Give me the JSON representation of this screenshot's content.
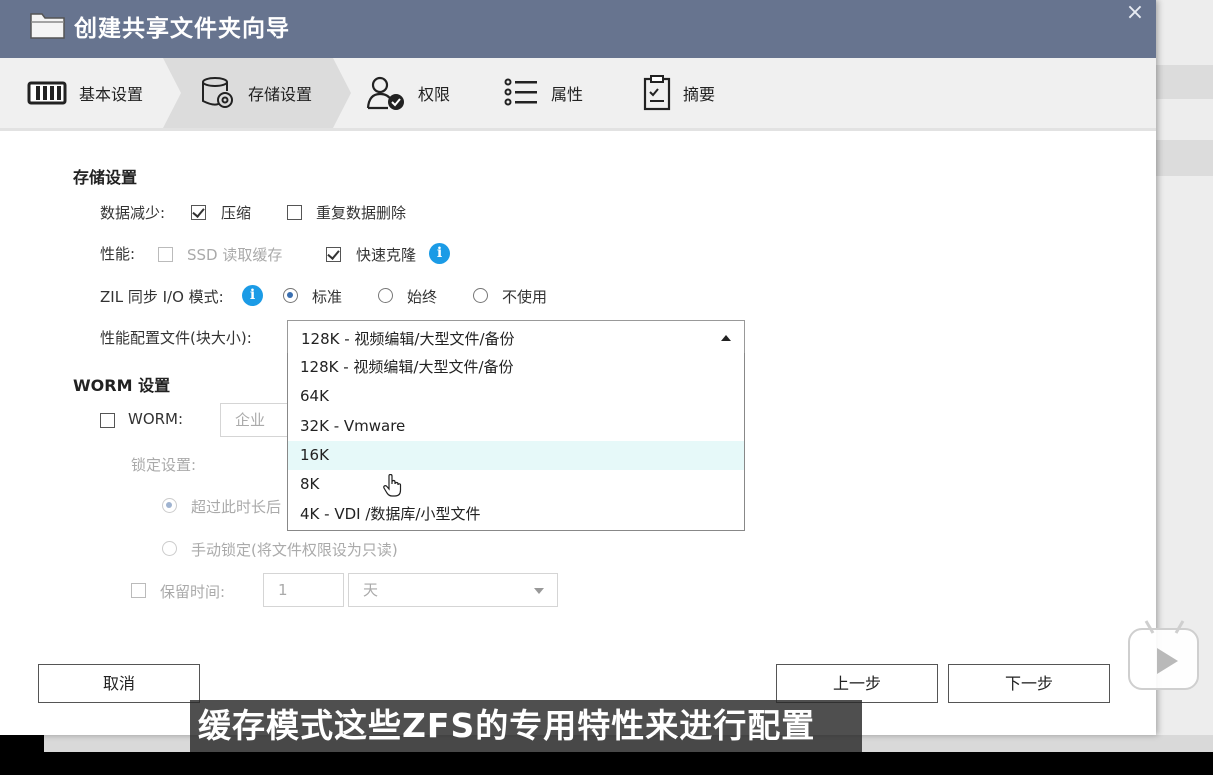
{
  "window": {
    "title": "创建共享文件夹向导",
    "close_glyph": "×"
  },
  "steps": [
    {
      "label": "基本设置",
      "icon": "hard-drive-icon"
    },
    {
      "label": "存储设置",
      "icon": "storage-gear-icon",
      "active": true
    },
    {
      "label": "权限",
      "icon": "user-check-icon"
    },
    {
      "label": "属性",
      "icon": "list-icon"
    },
    {
      "label": "摘要",
      "icon": "clipboard-icon"
    }
  ],
  "storage": {
    "section_title": "存储设置",
    "data_reduction_label": "数据减少:",
    "compression_label": "压缩",
    "compression_checked": true,
    "dedup_label": "重复数据删除",
    "dedup_checked": false,
    "performance_label": "性能:",
    "ssd_cache_label": "SSD 读取缓存",
    "ssd_cache_checked": false,
    "fast_clone_label": "快速克隆",
    "fast_clone_checked": true,
    "zil_label": "ZIL 同步 I/O 模式:",
    "zil_options": [
      "标准",
      "始终",
      "不使用"
    ],
    "zil_selected": "标准",
    "profile_label": "性能配置文件(块大小):",
    "profile_selected": "128K - 视频编辑/大型文件/备份",
    "profile_options": [
      "128K - 视频编辑/大型文件/备份",
      "64K",
      "32K - Vmware",
      "16K",
      "8K",
      "4K - VDI /数据库/小型文件"
    ],
    "profile_hover": "16K"
  },
  "worm": {
    "section_title": "WORM 设置",
    "worm_label": "WORM:",
    "worm_checked": false,
    "worm_type_placeholder": "企业",
    "lock_label": "锁定设置:",
    "lock_option1": "超过此时长后",
    "lock_option2": "手动锁定(将文件权限设为只读)",
    "retention_label": "保留时间:",
    "retention_value": "1",
    "retention_unit": "天"
  },
  "buttons": {
    "cancel": "取消",
    "prev": "上一步",
    "next": "下一步"
  },
  "info_glyph": "i",
  "overlay": {
    "subtitle": "缓存模式这些ZFS的专用特性来进行配置"
  },
  "colors": {
    "titlebar": "#67748f",
    "info": "#1b9be6",
    "hover_row": "#e6f9f9"
  }
}
